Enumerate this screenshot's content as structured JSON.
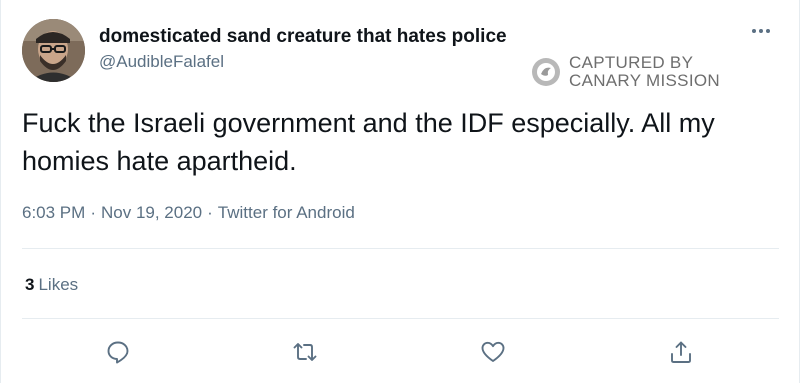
{
  "tweet": {
    "author": {
      "display_name": "domesticated sand creature that hates police",
      "handle": "@AudibleFalafel",
      "avatar": "avatar-photo"
    },
    "text": "Fuck the Israeli government and the IDF especially. All my homies hate apartheid.",
    "meta": {
      "time": "6:03 PM",
      "date": "Nov 19, 2020",
      "source": "Twitter for Android",
      "separator": "·"
    },
    "likes": {
      "count": "3",
      "label": "Likes"
    }
  },
  "watermark": {
    "line1": "CAPTURED BY",
    "line2": "CANARY MISSION",
    "icon": "canary-mission-logo"
  },
  "actions": {
    "reply": "reply-icon",
    "retweet": "retweet-icon",
    "like": "heart-icon",
    "share": "share-icon"
  },
  "colors": {
    "text_primary": "#0f1419",
    "text_secondary": "#5b7083",
    "divider": "#e6ecf0",
    "watermark": "#6e6e6e"
  }
}
